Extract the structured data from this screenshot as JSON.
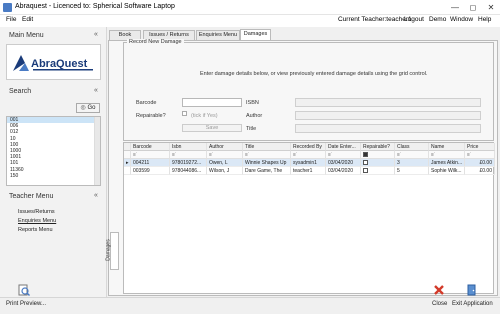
{
  "window": {
    "title": "Abraquest - Licenced to: Spherical Software Laptop"
  },
  "menubar": {
    "file": "File",
    "edit": "Edit",
    "current_teacher": "Current Teacher:teacher1",
    "logout": "Logout",
    "demo": "Demo",
    "window": "Window",
    "help": "Help"
  },
  "sidebar": {
    "main_menu": "Main Menu",
    "logo_text": "AbraQuest",
    "search_title": "Search",
    "go_label": "Go",
    "search_list": [
      "001",
      "006",
      "012",
      "10",
      "100",
      "1000",
      "1001",
      "101",
      "11360",
      "150"
    ],
    "teacher_menu": "Teacher Menu",
    "teacher_items": [
      "Issues/Returns",
      "Enquiries Menu",
      "Reports Menu"
    ]
  },
  "tabs": [
    "Book Search",
    "Issues / Returns",
    "Enquiries Menu",
    "Damages"
  ],
  "form": {
    "group_title": "Record New Damage",
    "instructions": "Enter damage details below, or view previously entered damage details using the grid control.",
    "barcode_label": "Barcode",
    "isbn_label": "ISBN",
    "repairable_label": "Repairable?",
    "tick_if_yes": "(tick if Yes)",
    "author_label": "Author",
    "title_label": "Title",
    "save_label": "Save"
  },
  "grid": {
    "columns": [
      "Barcode",
      "Isbn",
      "Author",
      "Title",
      "Recorded By",
      "Date Enter...",
      "Repairable?",
      "Class",
      "Name",
      "Price"
    ],
    "rows": [
      [
        "004211",
        "978019272...",
        "Owen, L",
        "Winnie Shapes Up",
        "sysadmin1",
        "03/04/2020",
        "",
        "3",
        "James Atkin...",
        "£0.00"
      ],
      [
        "003599",
        "978044086...",
        "Wilson, J",
        "Dare Game, The",
        "teacher1",
        "03/04/2020",
        "",
        "5",
        "Sophie Wilk...",
        "£0.00"
      ]
    ],
    "side_tab": "Damages"
  },
  "bottom": {
    "print_preview": "Print Preview...",
    "close": "Close",
    "exit": "Exit Application"
  },
  "colors": {
    "accent": "#4a7bc4",
    "close_red": "#d23a2a",
    "logo_blue": "#1a3b7a"
  }
}
